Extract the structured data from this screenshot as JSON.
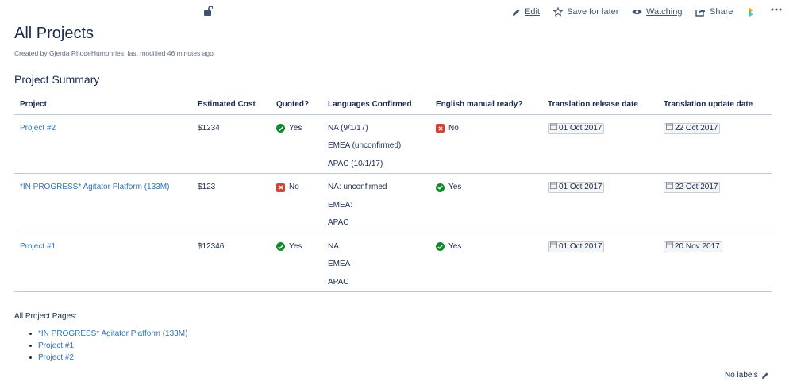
{
  "toolbar": {
    "edit_label": "Edit",
    "save_label": "Save for later",
    "watch_label": "Watching",
    "share_label": "Share"
  },
  "page": {
    "title": "All Projects",
    "byline": "Created by Gjerda RhodeHumphries, last modified 46 minutes ago",
    "section_title": "Project Summary"
  },
  "table": {
    "headers": [
      "Project",
      "Estimated Cost",
      "Quoted?",
      "Languages Confirmed",
      "English manual ready?",
      "Translation release date",
      "Translation update date"
    ],
    "rows": [
      {
        "project": "Project #2",
        "cost": "$1234",
        "quoted": "Yes",
        "quoted_ok": true,
        "languages": [
          "NA (9/1/17)",
          "EMEA (unconfirmed)",
          "APAC (10/1/17)"
        ],
        "manual": "No",
        "manual_ok": false,
        "release": "01 Oct 2017",
        "update": "22 Oct 2017"
      },
      {
        "project": "*IN PROGRESS* Agitator Platform (133M)",
        "cost": "$123",
        "quoted": "No",
        "quoted_ok": false,
        "languages": [
          "NA: unconfirmed",
          "EMEA:",
          "APAC"
        ],
        "manual": "Yes",
        "manual_ok": true,
        "release": "01 Oct 2017",
        "update": "22 Oct 2017"
      },
      {
        "project": "Project #1",
        "cost": "$12346",
        "quoted": "Yes",
        "quoted_ok": true,
        "languages": [
          "NA",
          "EMEA",
          "APAC"
        ],
        "manual": "Yes",
        "manual_ok": true,
        "release": "01 Oct 2017",
        "update": "20 Nov 2017"
      }
    ]
  },
  "pages": {
    "label": "All Project Pages:",
    "items": [
      "*IN PROGRESS* Agitator Platform (133M)",
      "Project #1",
      "Project #2"
    ]
  },
  "labels": {
    "text": "No labels"
  },
  "colors": {
    "link": "#3572b0",
    "success": "#14892c",
    "error": "#d04437"
  }
}
